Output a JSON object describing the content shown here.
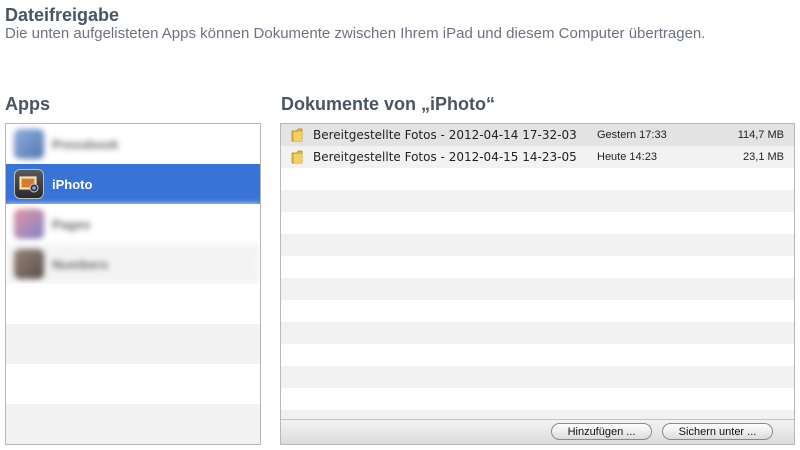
{
  "header": {
    "title": "Dateifreigabe",
    "description": "Die unten aufgelisteten Apps können Dokumente zwischen Ihrem iPad und diesem Computer übertragen."
  },
  "apps": {
    "title": "Apps",
    "items": [
      {
        "label": "Pressbook",
        "icon": "app-icon-blurred"
      },
      {
        "label": "iPhoto",
        "icon": "iphoto-icon",
        "selected": true
      },
      {
        "label": "Pages",
        "icon": "app-icon-blurred"
      },
      {
        "label": "Numbers",
        "icon": "app-icon-blurred"
      }
    ]
  },
  "documents": {
    "title": "Dokumente von „iPhoto“",
    "items": [
      {
        "name": "Bereitgestellte Fotos - 2012-04-14 17-32-03",
        "date": "Gestern 17:33",
        "size": "114,7 MB"
      },
      {
        "name": "Bereitgestellte Fotos - 2012-04-15 14-23-05",
        "date": "Heute 14:23",
        "size": "23,1 MB"
      }
    ],
    "add_button": "Hinzufügen ...",
    "save_button": "Sichern unter ..."
  },
  "colors": {
    "selection": "#3874d8",
    "heading": "#4a5563"
  }
}
